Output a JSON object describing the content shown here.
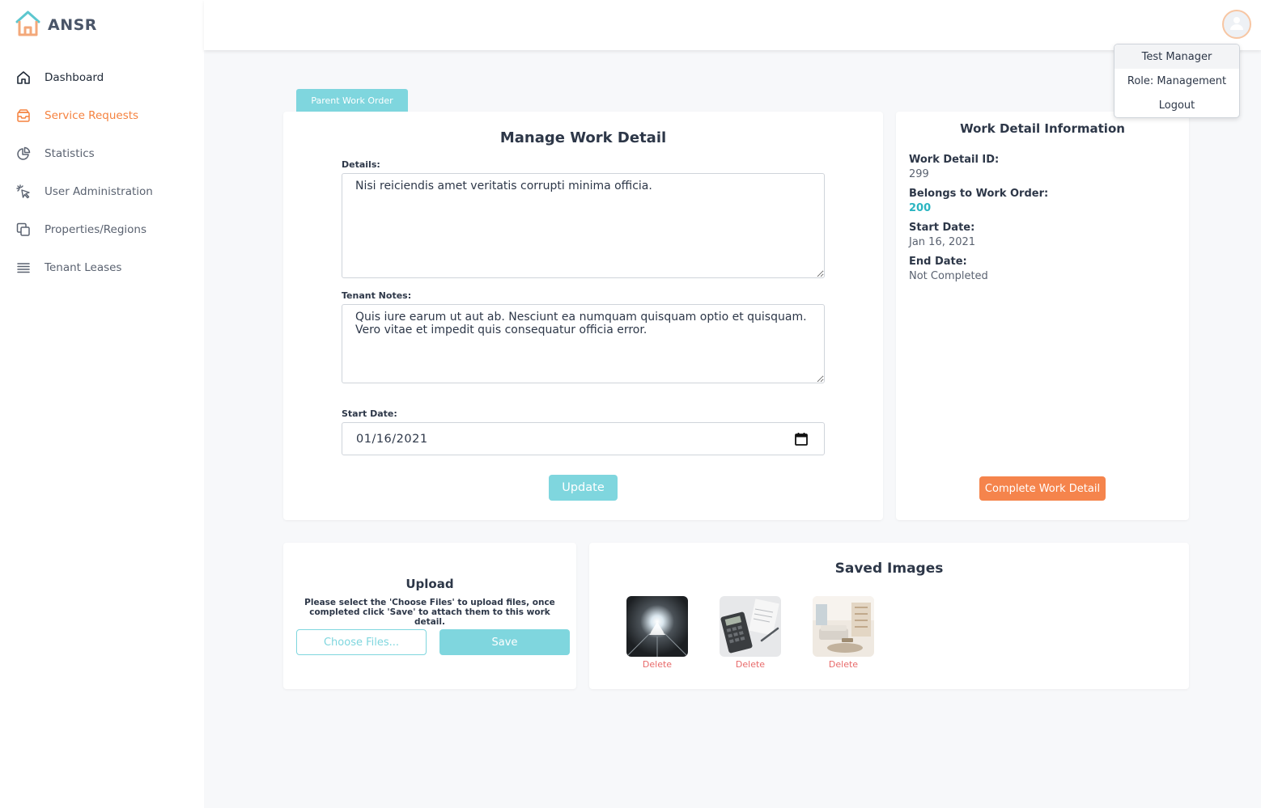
{
  "app": {
    "name": "ANSR"
  },
  "sidebar": {
    "items": [
      {
        "label": "Dashboard",
        "icon": "home-icon"
      },
      {
        "label": "Service Requests",
        "icon": "inbox-icon"
      },
      {
        "label": "Statistics",
        "icon": "pie-chart-icon"
      },
      {
        "label": "User Administration",
        "icon": "cursor-click-icon"
      },
      {
        "label": "Properties/Regions",
        "icon": "copy-icon"
      },
      {
        "label": "Tenant Leases",
        "icon": "list-icon"
      }
    ]
  },
  "user_menu": {
    "name": "Test Manager",
    "role": "Role: Management",
    "logout": "Logout"
  },
  "tab": {
    "label": "Parent Work Order"
  },
  "manage": {
    "title": "Manage Work Detail",
    "details_label": "Details:",
    "details_value": "Nisi reiciendis amet veritatis corrupti minima officia.",
    "notes_label": "Tenant Notes:",
    "notes_value": "Quis iure earum ut aut ab. Nesciunt ea numquam quisquam optio et quisquam. Vero vitae et impedit quis consequatur officia error.",
    "start_label": "Start Date:",
    "start_value": "01/16/2021",
    "update_label": "Update"
  },
  "info": {
    "title": "Work Detail Information",
    "id_label": "Work Detail ID:",
    "id_value": "299",
    "order_label": "Belongs to Work Order:",
    "order_value": "200",
    "start_label": "Start Date:",
    "start_value": "Jan 16, 2021",
    "end_label": "End Date:",
    "end_value": "Not Completed",
    "complete_label": "Complete Work Detail"
  },
  "upload": {
    "title": "Upload",
    "description": "Please select the 'Choose Files' to upload files, once completed click 'Save' to attach them to this work detail.",
    "choose_label": "Choose Files...",
    "save_label": "Save"
  },
  "images": {
    "title": "Saved Images",
    "delete_label": "Delete",
    "items": [
      {
        "subject": "light-tunnel"
      },
      {
        "subject": "calculator"
      },
      {
        "subject": "interior-room"
      }
    ]
  },
  "colors": {
    "accent": "#7fd6de",
    "orange": "#f5844c",
    "active_nav": "#f5823f",
    "link": "#2bb5c1",
    "delete": "#e86a6a"
  }
}
